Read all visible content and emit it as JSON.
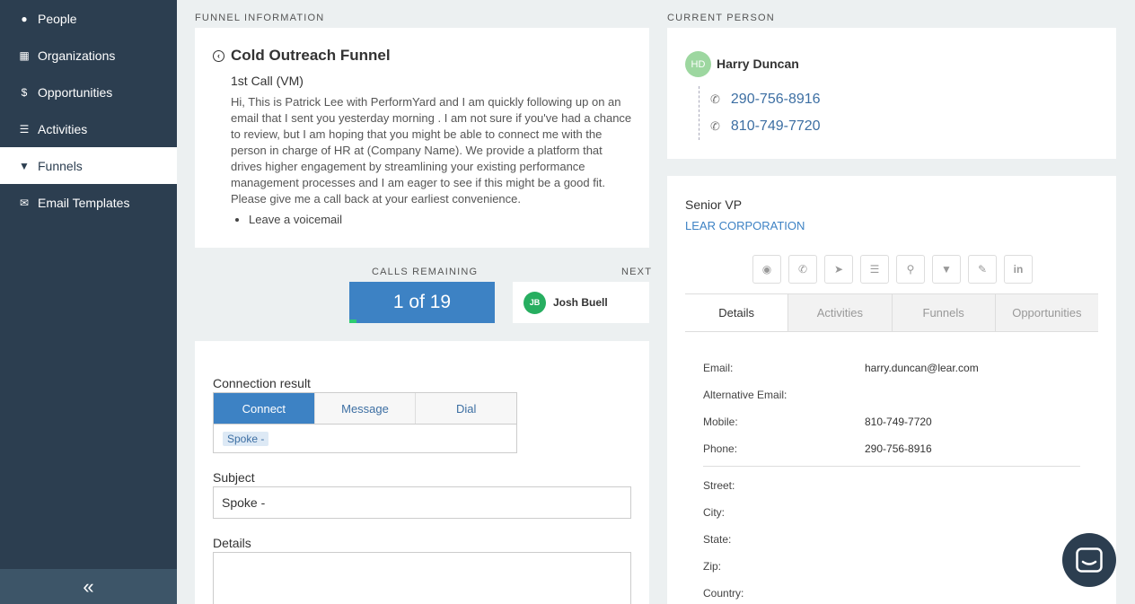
{
  "sidebar": {
    "items": [
      {
        "label": "People",
        "icon": "person-icon"
      },
      {
        "label": "Organizations",
        "icon": "building-icon"
      },
      {
        "label": "Opportunities",
        "icon": "dollar-icon"
      },
      {
        "label": "Activities",
        "icon": "list-icon"
      },
      {
        "label": "Funnels",
        "icon": "funnel-icon"
      },
      {
        "label": "Email Templates",
        "icon": "envelope-icon"
      }
    ],
    "active": "Funnels",
    "collapse_glyph": "«"
  },
  "funnel_info": {
    "section_label": "FUNNEL INFORMATION",
    "title": "Cold Outreach Funnel",
    "step": "1st Call (VM)",
    "script": "Hi, This is Patrick Lee with PerformYard and I am quickly following up on an email that I sent you yesterday morning . I am not sure if you've had a chance to review, but I am hoping that you might be able to connect me with the person in charge of HR at (Company Name). We provide a platform that drives higher engagement by streamlining your existing performance management processes and I am eager to see if this might be a good fit. Please give me a call back at your earliest convenience.",
    "bullets": [
      "Leave a voicemail"
    ]
  },
  "calls": {
    "label": "CALLS REMAINING",
    "value": "1 of 19",
    "progress": 0.05,
    "progress_color": "#2ecc71",
    "next_label": "NEXT",
    "next_initials": "JB",
    "next_name": "Josh Buell"
  },
  "form": {
    "connection_label": "Connection result",
    "options": [
      "Connect",
      "Message",
      "Dial"
    ],
    "selected": "Connect",
    "tag": "Spoke -",
    "subject_label": "Subject",
    "subject_value": "Spoke -",
    "details_label": "Details"
  },
  "current_person": {
    "section_label": "CURRENT PERSON",
    "initials": "HD",
    "name": "Harry Duncan",
    "phones": [
      "290-756-8916",
      "810-749-7720"
    ]
  },
  "person_details": {
    "title": "Senior VP",
    "company": "LEAR CORPORATION",
    "actions": [
      "eye-icon",
      "phone-icon",
      "send-icon",
      "list-icon",
      "pin-icon",
      "funnel-icon",
      "pencil-icon",
      "linkedin-icon"
    ],
    "tabs": [
      "Details",
      "Activities",
      "Funnels",
      "Opportunities"
    ],
    "active_tab": "Details",
    "fields": [
      {
        "label": "Email:",
        "value": "harry.duncan@lear.com"
      },
      {
        "label": "Alternative Email:",
        "value": ""
      },
      {
        "label": "Mobile:",
        "value": "810-749-7720"
      },
      {
        "label": "Phone:",
        "value": "290-756-8916"
      },
      {
        "label": "Street:",
        "value": ""
      },
      {
        "label": "City:",
        "value": ""
      },
      {
        "label": "State:",
        "value": ""
      },
      {
        "label": "Zip:",
        "value": ""
      },
      {
        "label": "Country:",
        "value": ""
      }
    ]
  },
  "colors": {
    "accent": "#3d82c4",
    "sidebar": "#2c3e50"
  }
}
